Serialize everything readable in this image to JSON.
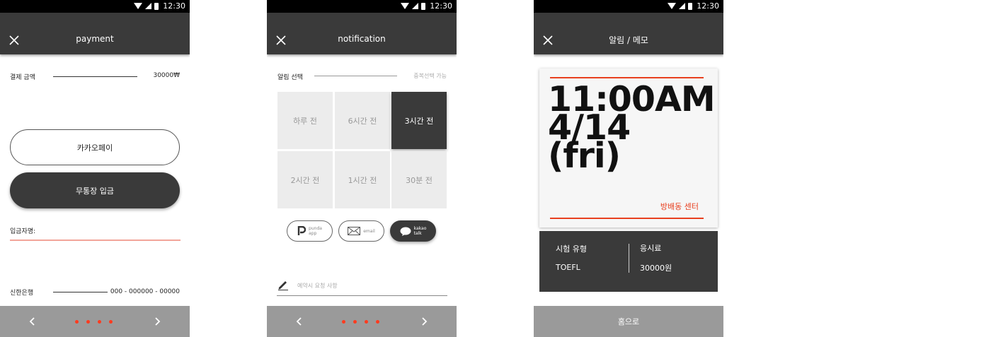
{
  "status": {
    "time": "12:30"
  },
  "payment": {
    "title": "payment",
    "amount_label": "결제 금액",
    "amount_value": "30000₩",
    "option_kakaopay": "카카오페이",
    "option_bank": "무통장 입금",
    "depositor_label": "입금자명:",
    "bank_name": "신한은행",
    "account_number": "000 - 000000 - 00000"
  },
  "notification": {
    "title": "notification",
    "select_label": "알림 선택",
    "multi_hint": "중복선택 가능",
    "options": [
      "하루 전",
      "6시간 전",
      "3시간 전",
      "2시간 전",
      "1시간 전",
      "30분 전"
    ],
    "selected_option": "3시간 전",
    "channels": [
      {
        "name": "punda app",
        "line1": "punda",
        "line2": "app",
        "selected": false
      },
      {
        "name": "email",
        "line1": "email",
        "line2": "",
        "selected": false
      },
      {
        "name": "kakao talk",
        "line1": "kakao",
        "line2": "talk",
        "selected": true
      }
    ],
    "memo_placeholder": "예약시 요청 사항"
  },
  "memo": {
    "title": "알림 / 메모",
    "time_line1": "11:00AM",
    "time_line2": "4/14",
    "time_line3": "(fri)",
    "venue": "방배동 센터",
    "exam_type_label": "시험 유형",
    "exam_type_value": "TOEFL",
    "fee_label": "응시료",
    "fee_value": "30000원",
    "home_label": "홈으로"
  },
  "colors": {
    "accent": "#e8401f",
    "dark": "#3a3a3a",
    "bar": "#9a9a9a"
  }
}
